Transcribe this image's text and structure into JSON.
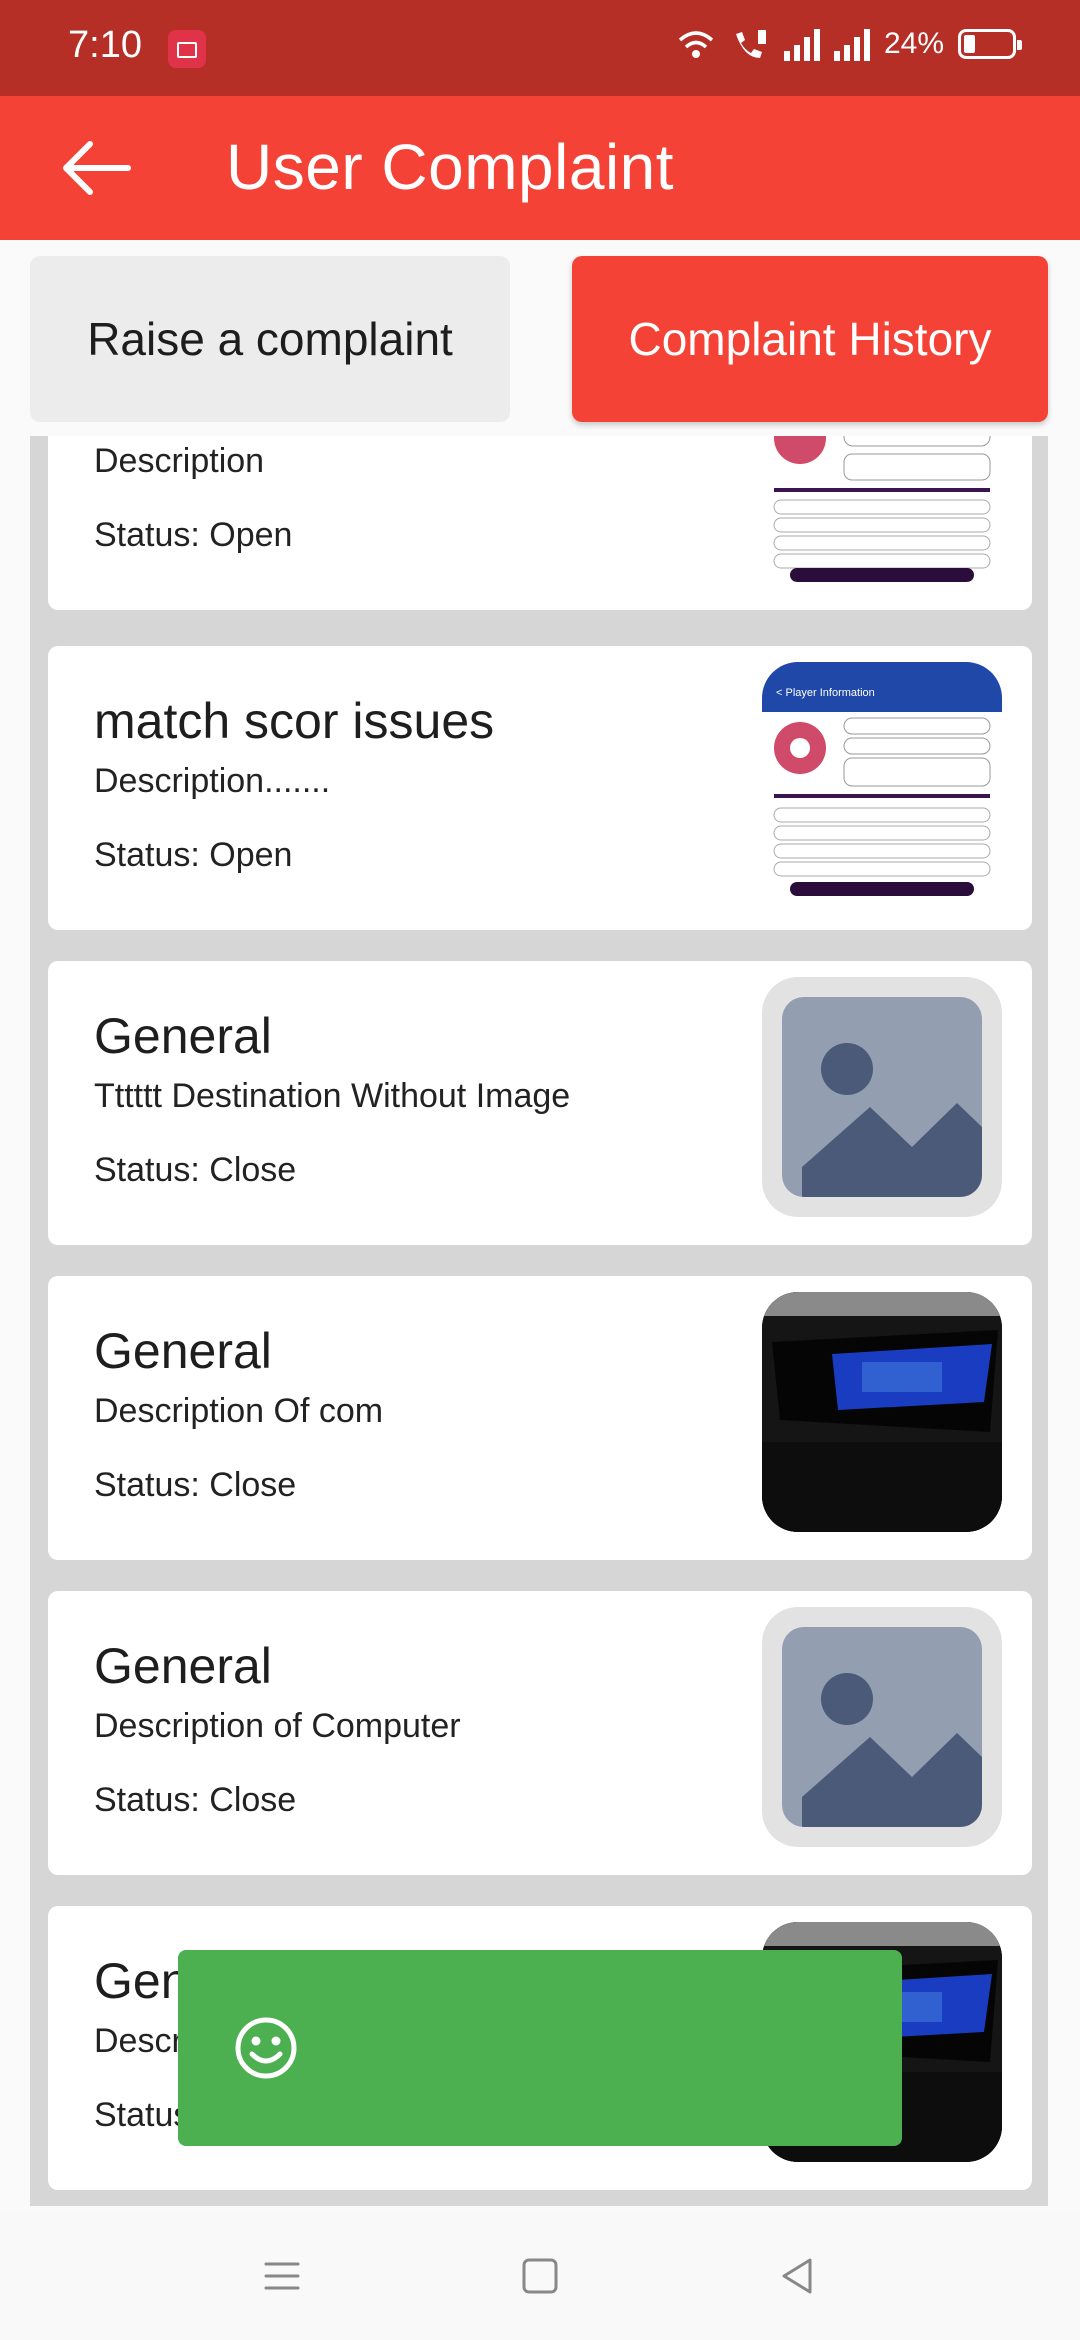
{
  "status_bar": {
    "time": "7:10",
    "battery": "24%",
    "icons": [
      "screen-record-icon",
      "wifi-icon",
      "call-signal-icon",
      "signal-icon",
      "signal-icon",
      "battery-icon"
    ]
  },
  "app_bar": {
    "title": "User Complaint",
    "back_icon": "arrow-left-icon"
  },
  "tabs": {
    "raise": "Raise a complaint",
    "history": "Complaint History",
    "active": "history"
  },
  "complaints": [
    {
      "title": "",
      "description": "Description",
      "status": "Status: Open",
      "thumbnail": "screenshot"
    },
    {
      "title": "match scor issues",
      "description": "Description.......",
      "status": "Status: Open",
      "thumbnail": "screenshot"
    },
    {
      "title": "General",
      "description": "Tttttt Destination Without Image",
      "status": "Status: Close",
      "thumbnail": "placeholder"
    },
    {
      "title": "General",
      "description": "Description Of com",
      "status": "Status: Close",
      "thumbnail": "photo"
    },
    {
      "title": "General",
      "description": "Description of Computer",
      "status": "Status: Close",
      "thumbnail": "placeholder"
    },
    {
      "title": "General",
      "description": "Description",
      "status": "Status",
      "thumbnail": "photo"
    }
  ],
  "snackbar": {
    "icon": "smiley-icon",
    "color": "#4caf50"
  },
  "nav_bar": {
    "icons": [
      "menu-icon",
      "home-square-icon",
      "back-triangle-icon"
    ]
  },
  "colors": {
    "primary": "#f44336",
    "status_bar": "#b52f26",
    "snackbar": "#4caf50"
  }
}
